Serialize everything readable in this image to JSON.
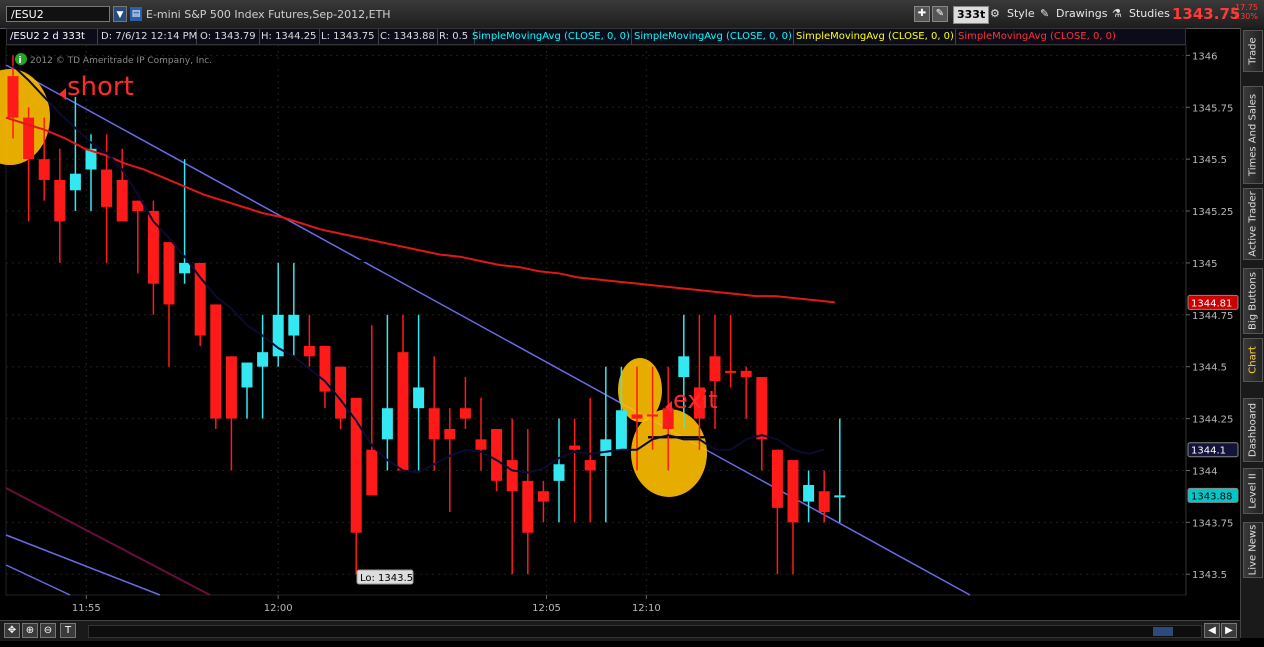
{
  "toolbar": {
    "symbol": "/ESU2",
    "description": "E-mini S&P 500 Index Futures,Sep-2012,ETH",
    "aggregation": "333t",
    "style_label": "Style",
    "drawings_label": "Drawings",
    "studies_label": "Studies",
    "last_price": "1343.75",
    "change": "-17.75",
    "change_pct": "-1.30%"
  },
  "infobar": {
    "symbol": "/ESU2 2 d 333t",
    "date": "D: 7/6/12 12:14 PM",
    "open": "O: 1343.79",
    "high": "H: 1344.25",
    "low": "L: 1343.75",
    "close": "C: 1343.88",
    "range": "R: 0.5",
    "studies": [
      {
        "label": "SimpleMovingAvg (CLOSE, 0, 0)",
        "color": "#00ffff"
      },
      {
        "label": "SimpleMovingAvg (CLOSE, 0, 0)",
        "color": "#00ffff"
      },
      {
        "label": "SimpleMovingAvg (CLOSE, 0, 0)",
        "color": "#ffff00"
      },
      {
        "label": "SimpleMovingAvg (CLOSE, 0, 0)",
        "color": "#ff3030"
      }
    ]
  },
  "right_tabs": [
    "Trade",
    "Times And Sales",
    "Active Trader",
    "Big Buttons",
    "Chart",
    "Dashboard",
    "Level II",
    "Live News"
  ],
  "chart_data": {
    "type": "candlestick",
    "copyright": "2012 © TD Ameritrade IP Company, Inc.",
    "ylim": [
      1343.4,
      1346.05
    ],
    "y_ticks": [
      "1346",
      "1345.75",
      "1345.5",
      "1345.25",
      "1345",
      "1344.75",
      "1344.5",
      "1344.25",
      "1344",
      "1343.75",
      "1343.5"
    ],
    "x_ticks": [
      {
        "label": "11:55",
        "bar": 4.7
      },
      {
        "label": "12:00",
        "bar": 17
      },
      {
        "label": "12:05",
        "bar": 34.2
      },
      {
        "label": "12:10",
        "bar": 40.6
      }
    ],
    "price_labels": [
      {
        "text": "1344.81",
        "value": 1344.81,
        "bg": "#cc0000",
        "fg": "#ffffff"
      },
      {
        "text": "1344.1",
        "value": 1344.1,
        "bg": "#14143a",
        "fg": "#ffffff"
      },
      {
        "text": "1343.88",
        "value": 1343.88,
        "bg": "#00c8c8",
        "fg": "#000000"
      }
    ],
    "candles": [
      [
        1345.9,
        1346.0,
        1345.6,
        1345.7
      ],
      [
        1345.7,
        1345.75,
        1345.2,
        1345.5
      ],
      [
        1345.5,
        1345.7,
        1345.3,
        1345.4
      ],
      [
        1345.4,
        1345.55,
        1345.0,
        1345.2
      ],
      [
        1345.35,
        1345.8,
        1345.25,
        1345.43
      ],
      [
        1345.45,
        1345.62,
        1345.25,
        1345.55
      ],
      [
        1345.45,
        1345.62,
        1345.0,
        1345.27
      ],
      [
        1345.4,
        1345.55,
        1345.25,
        1345.2
      ],
      [
        1345.3,
        1345.3,
        1344.95,
        1345.25
      ],
      [
        1345.25,
        1345.3,
        1344.75,
        1344.9
      ],
      [
        1345.1,
        1345.1,
        1344.5,
        1344.8
      ],
      [
        1344.95,
        1345.5,
        1344.9,
        1345.0
      ],
      [
        1345.0,
        1345.0,
        1344.6,
        1344.65
      ],
      [
        1344.8,
        1344.8,
        1344.2,
        1344.25
      ],
      [
        1344.55,
        1344.55,
        1344.0,
        1344.25
      ],
      [
        1344.4,
        1344.5,
        1344.25,
        1344.52
      ],
      [
        1344.5,
        1344.75,
        1344.25,
        1344.57
      ],
      [
        1344.55,
        1345.0,
        1344.5,
        1344.75
      ],
      [
        1344.65,
        1345.0,
        1344.55,
        1344.75
      ],
      [
        1344.6,
        1344.75,
        1344.5,
        1344.55
      ],
      [
        1344.6,
        1344.6,
        1344.3,
        1344.38
      ],
      [
        1344.5,
        1344.5,
        1344.2,
        1344.25
      ],
      [
        1344.35,
        1344.35,
        1343.5,
        1343.7
      ],
      [
        1344.1,
        1344.7,
        1343.9,
        1343.88
      ],
      [
        1344.15,
        1344.75,
        1344.0,
        1344.3
      ],
      [
        1344.57,
        1344.75,
        1344.0,
        1344.0
      ],
      [
        1344.3,
        1344.75,
        1344.0,
        1344.4
      ],
      [
        1344.3,
        1344.55,
        1344.0,
        1344.15
      ],
      [
        1344.2,
        1344.3,
        1343.8,
        1344.15
      ],
      [
        1344.3,
        1344.45,
        1344.2,
        1344.25
      ],
      [
        1344.15,
        1344.35,
        1344.0,
        1344.1
      ],
      [
        1344.2,
        1344.2,
        1343.9,
        1343.95
      ],
      [
        1344.05,
        1344.25,
        1343.5,
        1343.9
      ],
      [
        1343.95,
        1344.2,
        1343.5,
        1343.7
      ],
      [
        1343.9,
        1343.95,
        1343.75,
        1343.85
      ],
      [
        1343.95,
        1344.25,
        1343.75,
        1344.03
      ],
      [
        1344.12,
        1344.25,
        1343.75,
        1344.1
      ],
      [
        1344.05,
        1344.35,
        1343.75,
        1344.0
      ],
      [
        1344.07,
        1344.5,
        1343.75,
        1344.15
      ],
      [
        1344.1,
        1344.5,
        1344.1,
        1344.29
      ],
      [
        1344.27,
        1344.5,
        1344.0,
        1344.25
      ],
      [
        1344.27,
        1344.5,
        1344.1,
        1344.26
      ],
      [
        1344.3,
        1344.5,
        1344.0,
        1344.2
      ],
      [
        1344.45,
        1344.75,
        1344.2,
        1344.55
      ],
      [
        1344.4,
        1344.75,
        1344.1,
        1344.25
      ],
      [
        1344.55,
        1344.75,
        1344.2,
        1344.43
      ],
      [
        1344.48,
        1344.75,
        1344.4,
        1344.47
      ],
      [
        1344.48,
        1344.5,
        1344.25,
        1344.45
      ],
      [
        1344.45,
        1344.45,
        1344.0,
        1344.15
      ],
      [
        1344.1,
        1344.1,
        1343.5,
        1343.82
      ],
      [
        1344.05,
        1344.05,
        1343.5,
        1343.75
      ],
      [
        1343.85,
        1344.0,
        1343.75,
        1343.93
      ],
      [
        1343.9,
        1344.0,
        1343.75,
        1343.8
      ],
      [
        1343.88,
        1344.25,
        1343.75,
        1343.88
      ]
    ],
    "sma_fast": [
      1345.95,
      1345.88,
      1345.8,
      1345.72,
      1345.65,
      1345.58,
      1345.53,
      1345.45,
      1345.33,
      1345.2,
      1345.12,
      1345.03,
      1344.93,
      1344.84,
      1344.78,
      1344.7,
      1344.65,
      1344.59,
      1344.55,
      1344.49,
      1344.43,
      1344.34,
      1344.24,
      1344.12,
      1344.05,
      1344.0,
      1343.99,
      1344.03,
      1344.07,
      1344.1,
      1344.09,
      1344.05,
      1344.0,
      1343.99,
      1344.01,
      1344.06,
      1344.09,
      1344.08,
      1344.09,
      1344.1,
      1344.1,
      1344.15,
      1344.17,
      1344.15,
      1344.15,
      1344.1,
      1344.1,
      1344.15,
      1344.17,
      1344.15,
      1344.1,
      1344.08,
      1344.1
    ],
    "sma_slow": [
      1345.7,
      1345.67,
      1345.64,
      1345.6,
      1345.55,
      1345.52,
      1345.48,
      1345.45,
      1345.41,
      1345.37,
      1345.33,
      1345.3,
      1345.27,
      1345.24,
      1345.22,
      1345.19,
      1345.16,
      1345.14,
      1345.12,
      1345.1,
      1345.08,
      1345.06,
      1345.04,
      1345.03,
      1345.01,
      1344.99,
      1344.98,
      1344.96,
      1344.95,
      1344.93,
      1344.92,
      1344.91,
      1344.9,
      1344.89,
      1344.88,
      1344.87,
      1344.86,
      1344.85,
      1344.84,
      1344.84,
      1344.83,
      1344.82,
      1344.81
    ],
    "horizontal_lines": [
      1345.96,
      1345.01,
      1344.16
    ],
    "annotations": {
      "short": "short",
      "exit": "exit",
      "low": "Lo: 1343.5"
    }
  }
}
